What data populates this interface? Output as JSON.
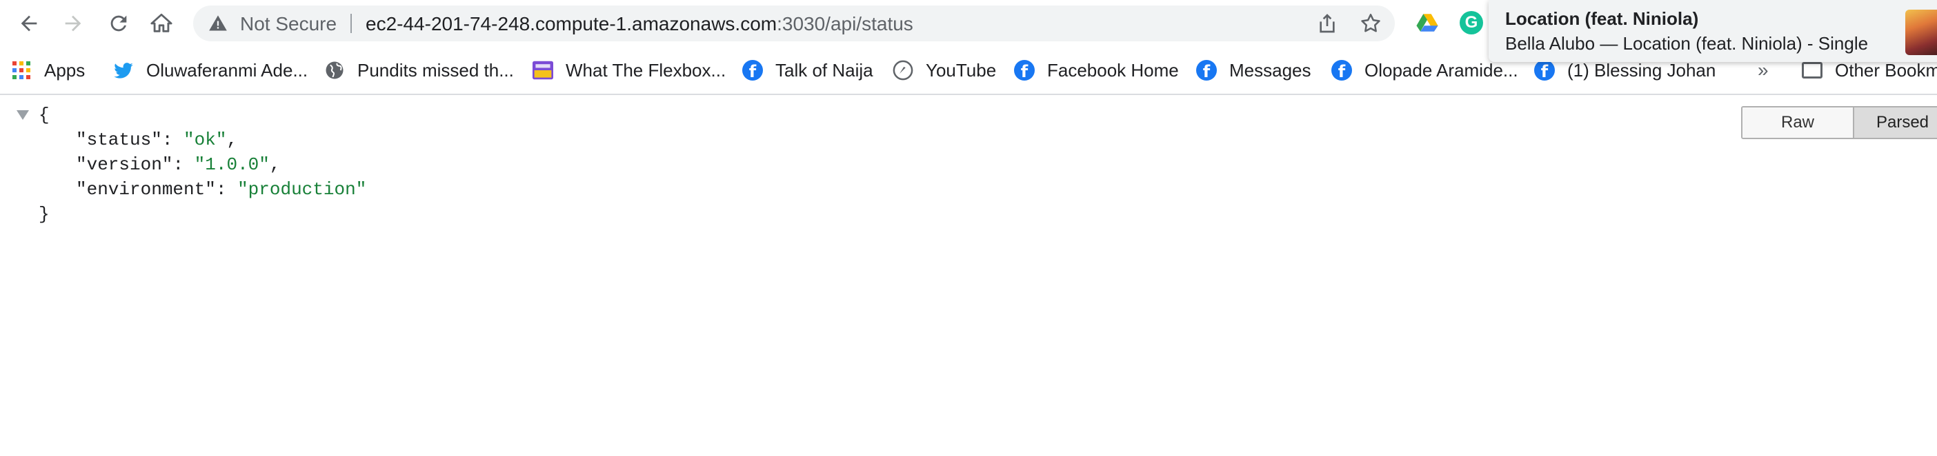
{
  "toolbar": {
    "security_label": "Not Secure",
    "url_host": "ec2-44-201-74-248.compute-1.amazonaws.com",
    "url_path": ":3030/api/status"
  },
  "bookmarks": {
    "items": [
      {
        "label": "Apps",
        "icon": "apps-grid-icon"
      },
      {
        "label": "Oluwaferanmi Ade...",
        "icon": "twitter-icon"
      },
      {
        "label": "Pundits missed th...",
        "icon": "globe-icon"
      },
      {
        "label": "What The Flexbox...",
        "icon": "flexbox-icon"
      },
      {
        "label": "Talk of Naija",
        "icon": "facebook-icon"
      },
      {
        "label": "YouTube",
        "icon": "youtube-icon"
      },
      {
        "label": "Facebook Home",
        "icon": "facebook-icon"
      },
      {
        "label": "Messages",
        "icon": "facebook-icon"
      },
      {
        "label": "Olopade Aramide...",
        "icon": "facebook-icon"
      },
      {
        "label": "(1) Blessing Johan",
        "icon": "facebook-icon"
      }
    ],
    "overflow": "»",
    "other_label": "Other Bookma"
  },
  "media": {
    "title": "Location (feat. Niniola)",
    "subtitle": "Bella Alubo — Location (feat. Niniola) - Single"
  },
  "json_view": {
    "open_brace": "{",
    "close_brace": "}",
    "entries": [
      {
        "key": "\"status\"",
        "value": "\"ok\"",
        "trail": ","
      },
      {
        "key": "\"version\"",
        "value": "\"1.0.0\"",
        "trail": ","
      },
      {
        "key": "\"environment\"",
        "value": "\"production\"",
        "trail": ""
      }
    ],
    "raw_label": "Raw",
    "parsed_label": "Parsed"
  },
  "colors": {
    "json_string": "#188038",
    "facebook": "#1877f2",
    "grammarly": "#15c39a"
  }
}
